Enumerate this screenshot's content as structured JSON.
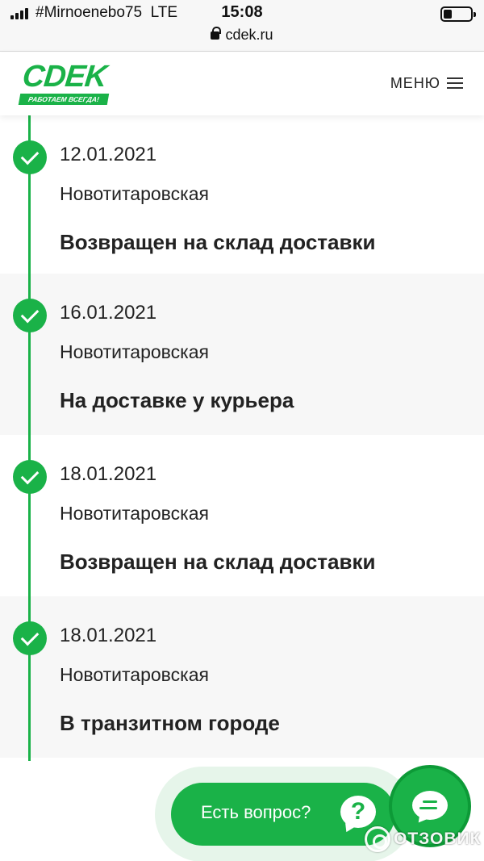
{
  "status_bar": {
    "carrier": "#Mirnoenebo75",
    "network": "LTE",
    "time": "15:08",
    "url": "cdek.ru"
  },
  "header": {
    "logo_text": "CDEK",
    "logo_slogan": "РАБОТАЕМ ВСЕГДА!",
    "menu_label": "МЕНЮ"
  },
  "colors": {
    "brand_green": "#1ab248",
    "row_shade": "#f7f7f7"
  },
  "events": [
    {
      "date": "12.01.2021",
      "city": "Новотитаровская",
      "status": "Возвращен на склад доставки"
    },
    {
      "date": "16.01.2021",
      "city": "Новотитаровская",
      "status": "На доставке у курьера"
    },
    {
      "date": "18.01.2021",
      "city": "Новотитаровская",
      "status": "Возвращен на склад доставки"
    },
    {
      "date": "18.01.2021",
      "city": "Новотитаровская",
      "status": "В транзитном городе"
    }
  ],
  "help": {
    "label": "Есть вопрос?",
    "question_mark": "?"
  },
  "watermark": {
    "text": "ОТЗОВИК"
  },
  "icons": [
    "signal-icon",
    "battery-icon",
    "lock-icon",
    "burger-menu-icon",
    "check-icon",
    "question-icon",
    "chat-icon"
  ]
}
